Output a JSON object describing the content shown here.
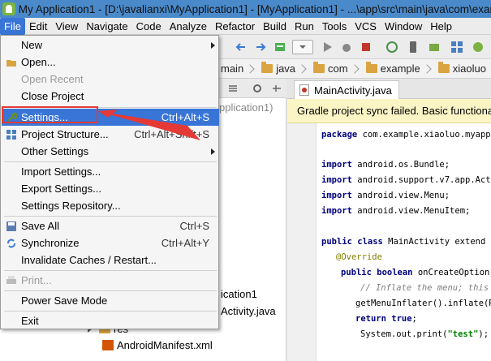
{
  "window": {
    "title": "My Application1 - [D:\\javalianxi\\MyApplication1] - [MyApplication1] - ...\\app\\src\\main\\java\\com\\exam"
  },
  "menubar": {
    "items": [
      "File",
      "Edit",
      "View",
      "Navigate",
      "Code",
      "Analyze",
      "Refactor",
      "Build",
      "Run",
      "Tools",
      "VCS",
      "Window",
      "Help"
    ]
  },
  "breadcrumbs": [
    "main",
    "java",
    "com",
    "example",
    "xiaoluo"
  ],
  "left_panel": {
    "header_text": "pplication1)",
    "tree": [
      "ication1",
      "Activity.java",
      "res",
      "AndroidManifest.xml"
    ]
  },
  "editor": {
    "tab_label": "MainActivity.java",
    "banner": "Gradle project sync failed. Basic functional",
    "code_lines": [
      {
        "k": "package",
        "t": " com.example.xiaoluo.myappl"
      },
      {
        "k": "import",
        "t": " android.os.Bundle;"
      },
      {
        "k": "import",
        "t": " android.support.v7.app.Acti"
      },
      {
        "k": "import",
        "t": " android.view.Menu;"
      },
      {
        "k": "import",
        "t": " android.view.MenuItem;"
      },
      {
        "k": "public class",
        "t": " MainActivity extend"
      },
      {
        "a": "@Override"
      },
      {
        "k": "public boolean",
        "t": " onCreateOption"
      },
      {
        "c": "// Inflate the menu; this a"
      },
      {
        "t": "getMenuInflater().inflate(R."
      },
      {
        "k": "return true",
        "t": ";"
      },
      {
        "t": "System.out.print(",
        "s": "\"test\"",
        "e": ");"
      }
    ]
  },
  "file_menu": {
    "items": [
      {
        "label": "New",
        "submenu": true
      },
      {
        "label": "Open..."
      },
      {
        "label": "Open Recent",
        "disabled": true,
        "submenu": true
      },
      {
        "label": "Close Project"
      },
      {
        "label": "Settings...",
        "shortcut": "Ctrl+Alt+S",
        "highlighted": true
      },
      {
        "label": "Project Structure...",
        "shortcut": "Ctrl+Alt+Shift+S"
      },
      {
        "label": "Other Settings",
        "submenu": true
      },
      {
        "label": "Import Settings..."
      },
      {
        "label": "Export Settings..."
      },
      {
        "label": "Settings Repository..."
      },
      {
        "label": "Save All",
        "shortcut": "Ctrl+S"
      },
      {
        "label": "Synchronize",
        "shortcut": "Ctrl+Alt+Y"
      },
      {
        "label": "Invalidate Caches / Restart..."
      },
      {
        "label": "Print...",
        "disabled": true
      },
      {
        "label": "Power Save Mode"
      },
      {
        "label": "Exit"
      }
    ]
  },
  "colors": {
    "accent": "#3875d7",
    "annotation": "#e53935",
    "banner": "#fbf5c6"
  }
}
